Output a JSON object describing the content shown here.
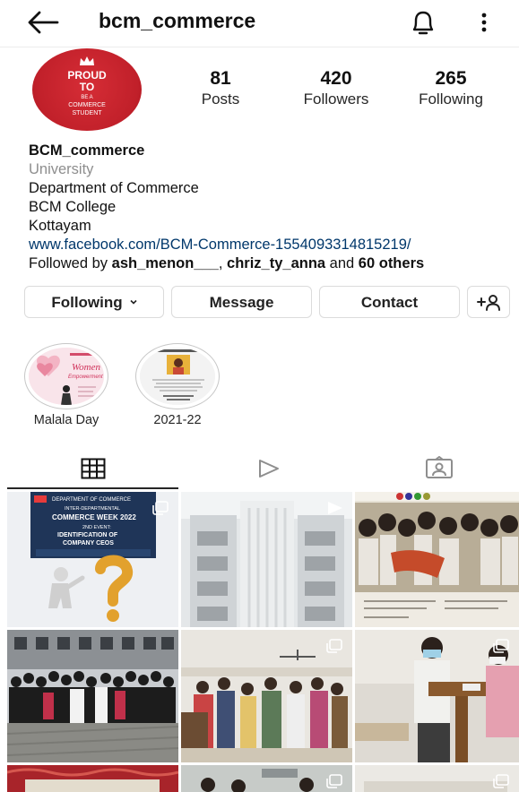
{
  "header": {
    "username": "bcm_commerce"
  },
  "avatar": {
    "line1": "PROUD",
    "line2": "TO",
    "line3": "BE A",
    "line4": "COMMERCE",
    "line5": "STUDENT"
  },
  "stats": [
    {
      "value": "81",
      "label": "Posts"
    },
    {
      "value": "420",
      "label": "Followers"
    },
    {
      "value": "265",
      "label": "Following"
    }
  ],
  "bio": {
    "name": "BCM_commerce",
    "category": "University",
    "lines": [
      "Department of Commerce",
      "BCM College",
      "Kottayam"
    ],
    "link": "www.facebook.com/BCM-Commerce-1554093314815219/",
    "followed_by_prefix": "Followed by ",
    "followed_user_1": "ash_menon___",
    "separator": ", ",
    "followed_user_2": "chriz_ty_anna",
    "and_text": " and ",
    "others": "60 others"
  },
  "actions": {
    "following": "Following",
    "message": "Message",
    "contact": "Contact"
  },
  "highlights": [
    {
      "label": "Malala Day"
    },
    {
      "label": "2021-22"
    }
  ],
  "highlight_art": {
    "women": "Women",
    "empowerment": "Empowerment"
  },
  "posts": {
    "p1_line1": "DEPARTMENT OF COMMERCE",
    "p1_line2": "INTER-DEPARTMENTAL",
    "p1_line3": "COMMERCE WEEK 2022",
    "p1_line4": "2ND EVENT:",
    "p1_line5": "IDENTIFICATION OF",
    "p1_line6": "COMPANY CEOS"
  },
  "colors": {
    "link": "#00376b",
    "secondary_text": "#8e8e8e",
    "border": "#dbdbdb"
  }
}
